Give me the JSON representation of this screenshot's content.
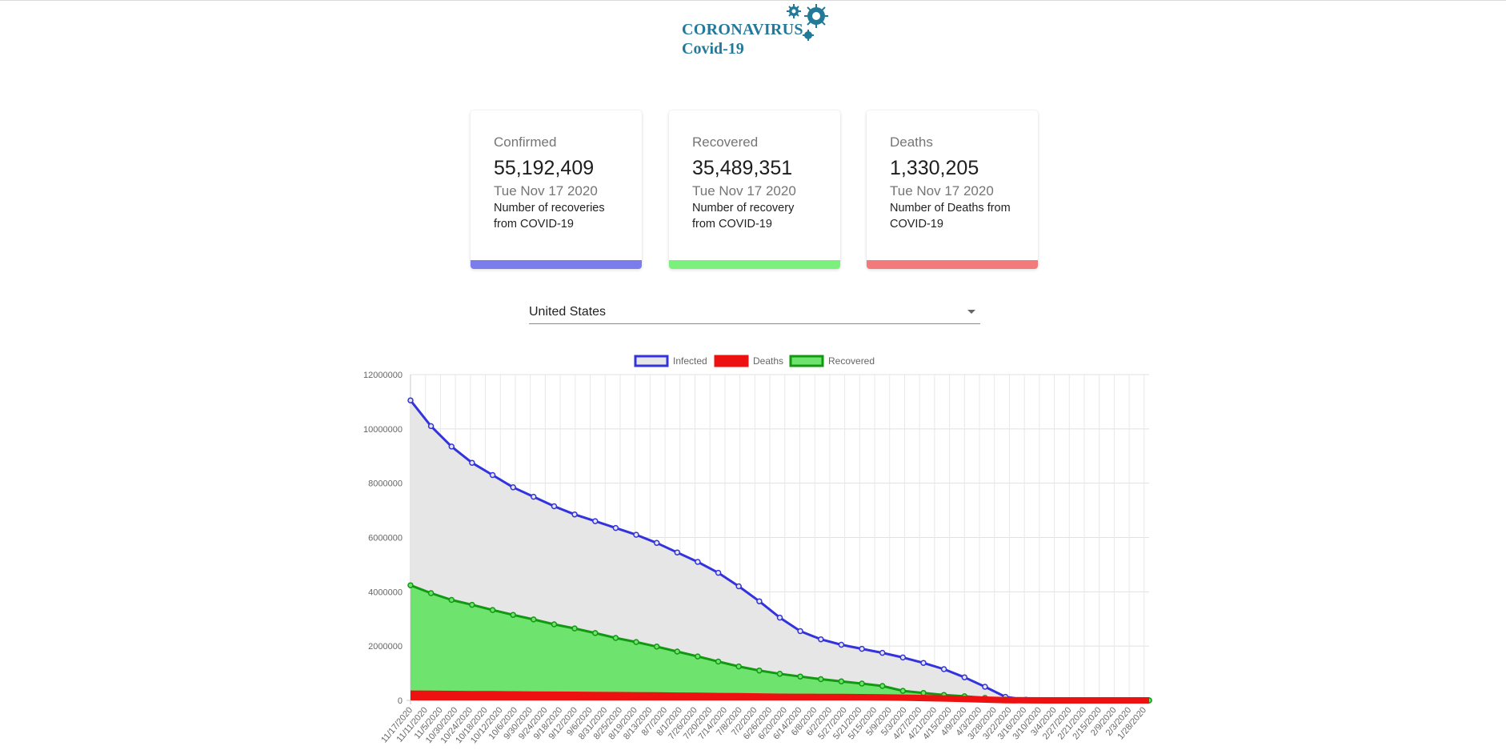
{
  "logo": {
    "line1": "CORONAVIRUS",
    "line2": "Covid-19",
    "icon": "virus-icon"
  },
  "cards": [
    {
      "title": "Confirmed",
      "value": "55,192,409",
      "date": "Tue Nov 17 2020",
      "description": "Number of recoveries from COVID-19",
      "color": "#7b7ded"
    },
    {
      "title": "Recovered",
      "value": "35,489,351",
      "date": "Tue Nov 17 2020",
      "description": "Number of recovery from COVID-19",
      "color": "#7cf07c"
    },
    {
      "title": "Deaths",
      "value": "1,330,205",
      "date": "Tue Nov 17 2020",
      "description": "Number of Deaths from COVID-19",
      "color": "#f27a7a"
    }
  ],
  "country_select": {
    "value": "United States",
    "icon": "chevron-down-icon"
  },
  "chart_data": {
    "type": "area",
    "title": "",
    "xlabel": "",
    "ylabel": "",
    "ylim": [
      0,
      12000000
    ],
    "yticks": [
      0,
      2000000,
      4000000,
      6000000,
      8000000,
      10000000,
      12000000
    ],
    "grid": true,
    "legend_position": "top",
    "x_tick_labels": [
      "11/17/2020",
      "11/11/2020",
      "11/5/2020",
      "10/30/2020",
      "10/24/2020",
      "10/18/2020",
      "10/12/2020",
      "10/6/2020",
      "9/30/2020",
      "9/24/2020",
      "9/18/2020",
      "9/12/2020",
      "9/6/2020",
      "8/31/2020",
      "8/25/2020",
      "8/19/2020",
      "8/13/2020",
      "8/7/2020",
      "8/1/2020",
      "7/26/2020",
      "7/20/2020",
      "7/14/2020",
      "7/8/2020",
      "7/2/2020",
      "6/26/2020",
      "6/20/2020",
      "6/14/2020",
      "6/8/2020",
      "6/2/2020",
      "5/27/2020",
      "5/21/2020",
      "5/15/2020",
      "5/9/2020",
      "5/3/2020",
      "4/27/2020",
      "4/21/2020",
      "4/15/2020",
      "4/9/2020",
      "4/3/2020",
      "3/28/2020",
      "3/22/2020",
      "3/16/2020",
      "3/10/2020",
      "3/4/2020",
      "2/27/2020",
      "2/21/2020",
      "2/15/2020",
      "2/9/2020",
      "2/3/2020",
      "1/28/2020"
    ],
    "x_range": [
      "11/17/2020",
      "1/22/2020"
    ],
    "series": [
      {
        "name": "Infected",
        "border_color": "#3333dd",
        "fill_color": "#e6e6e6",
        "values": [
          11050000,
          10100000,
          9350000,
          8750000,
          8300000,
          7850000,
          7500000,
          7150000,
          6850000,
          6600000,
          6350000,
          6100000,
          5800000,
          5450000,
          5100000,
          4700000,
          4200000,
          3650000,
          3050000,
          2550000,
          2250000,
          2050000,
          1900000,
          1750000,
          1580000,
          1380000,
          1150000,
          850000,
          500000,
          130000,
          20000,
          0,
          0,
          0,
          0,
          0,
          0
        ]
      },
      {
        "name": "Deaths",
        "border_color": "#ee1111",
        "fill_color": "#ee1111",
        "values": [
          249000,
          243000,
          237000,
          231000,
          226000,
          220000,
          215000,
          210000,
          205000,
          199000,
          194000,
          188000,
          182000,
          175000,
          168000,
          160000,
          152000,
          143000,
          134000,
          130000,
          127000,
          124000,
          118000,
          110000,
          100000,
          86000,
          70000,
          50000,
          30000,
          8000,
          2000,
          0,
          0,
          0,
          0,
          0,
          0
        ]
      },
      {
        "name": "Recovered",
        "border_color": "#119911",
        "fill_color": "#6ee36e",
        "values": [
          4240000,
          3950000,
          3700000,
          3520000,
          3330000,
          3150000,
          2980000,
          2800000,
          2650000,
          2480000,
          2300000,
          2150000,
          1980000,
          1800000,
          1620000,
          1430000,
          1250000,
          1100000,
          980000,
          880000,
          780000,
          700000,
          620000,
          530000,
          350000,
          270000,
          200000,
          150000,
          90000,
          30000,
          5000,
          0,
          0,
          0,
          0,
          0,
          0
        ]
      }
    ]
  }
}
